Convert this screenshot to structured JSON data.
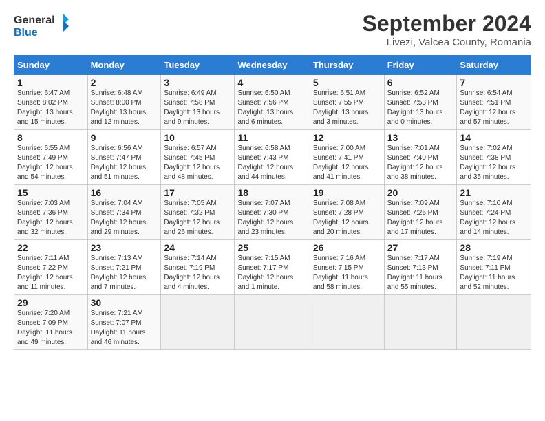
{
  "header": {
    "logo_line1": "General",
    "logo_line2": "Blue",
    "month": "September 2024",
    "location": "Livezi, Valcea County, Romania"
  },
  "weekdays": [
    "Sunday",
    "Monday",
    "Tuesday",
    "Wednesday",
    "Thursday",
    "Friday",
    "Saturday"
  ],
  "weeks": [
    [
      {
        "day": "1",
        "info": "Sunrise: 6:47 AM\nSunset: 8:02 PM\nDaylight: 13 hours\nand 15 minutes."
      },
      {
        "day": "2",
        "info": "Sunrise: 6:48 AM\nSunset: 8:00 PM\nDaylight: 13 hours\nand 12 minutes."
      },
      {
        "day": "3",
        "info": "Sunrise: 6:49 AM\nSunset: 7:58 PM\nDaylight: 13 hours\nand 9 minutes."
      },
      {
        "day": "4",
        "info": "Sunrise: 6:50 AM\nSunset: 7:56 PM\nDaylight: 13 hours\nand 6 minutes."
      },
      {
        "day": "5",
        "info": "Sunrise: 6:51 AM\nSunset: 7:55 PM\nDaylight: 13 hours\nand 3 minutes."
      },
      {
        "day": "6",
        "info": "Sunrise: 6:52 AM\nSunset: 7:53 PM\nDaylight: 13 hours\nand 0 minutes."
      },
      {
        "day": "7",
        "info": "Sunrise: 6:54 AM\nSunset: 7:51 PM\nDaylight: 12 hours\nand 57 minutes."
      }
    ],
    [
      {
        "day": "8",
        "info": "Sunrise: 6:55 AM\nSunset: 7:49 PM\nDaylight: 12 hours\nand 54 minutes."
      },
      {
        "day": "9",
        "info": "Sunrise: 6:56 AM\nSunset: 7:47 PM\nDaylight: 12 hours\nand 51 minutes."
      },
      {
        "day": "10",
        "info": "Sunrise: 6:57 AM\nSunset: 7:45 PM\nDaylight: 12 hours\nand 48 minutes."
      },
      {
        "day": "11",
        "info": "Sunrise: 6:58 AM\nSunset: 7:43 PM\nDaylight: 12 hours\nand 44 minutes."
      },
      {
        "day": "12",
        "info": "Sunrise: 7:00 AM\nSunset: 7:41 PM\nDaylight: 12 hours\nand 41 minutes."
      },
      {
        "day": "13",
        "info": "Sunrise: 7:01 AM\nSunset: 7:40 PM\nDaylight: 12 hours\nand 38 minutes."
      },
      {
        "day": "14",
        "info": "Sunrise: 7:02 AM\nSunset: 7:38 PM\nDaylight: 12 hours\nand 35 minutes."
      }
    ],
    [
      {
        "day": "15",
        "info": "Sunrise: 7:03 AM\nSunset: 7:36 PM\nDaylight: 12 hours\nand 32 minutes."
      },
      {
        "day": "16",
        "info": "Sunrise: 7:04 AM\nSunset: 7:34 PM\nDaylight: 12 hours\nand 29 minutes."
      },
      {
        "day": "17",
        "info": "Sunrise: 7:05 AM\nSunset: 7:32 PM\nDaylight: 12 hours\nand 26 minutes."
      },
      {
        "day": "18",
        "info": "Sunrise: 7:07 AM\nSunset: 7:30 PM\nDaylight: 12 hours\nand 23 minutes."
      },
      {
        "day": "19",
        "info": "Sunrise: 7:08 AM\nSunset: 7:28 PM\nDaylight: 12 hours\nand 20 minutes."
      },
      {
        "day": "20",
        "info": "Sunrise: 7:09 AM\nSunset: 7:26 PM\nDaylight: 12 hours\nand 17 minutes."
      },
      {
        "day": "21",
        "info": "Sunrise: 7:10 AM\nSunset: 7:24 PM\nDaylight: 12 hours\nand 14 minutes."
      }
    ],
    [
      {
        "day": "22",
        "info": "Sunrise: 7:11 AM\nSunset: 7:22 PM\nDaylight: 12 hours\nand 11 minutes."
      },
      {
        "day": "23",
        "info": "Sunrise: 7:13 AM\nSunset: 7:21 PM\nDaylight: 12 hours\nand 7 minutes."
      },
      {
        "day": "24",
        "info": "Sunrise: 7:14 AM\nSunset: 7:19 PM\nDaylight: 12 hours\nand 4 minutes."
      },
      {
        "day": "25",
        "info": "Sunrise: 7:15 AM\nSunset: 7:17 PM\nDaylight: 12 hours\nand 1 minute."
      },
      {
        "day": "26",
        "info": "Sunrise: 7:16 AM\nSunset: 7:15 PM\nDaylight: 11 hours\nand 58 minutes."
      },
      {
        "day": "27",
        "info": "Sunrise: 7:17 AM\nSunset: 7:13 PM\nDaylight: 11 hours\nand 55 minutes."
      },
      {
        "day": "28",
        "info": "Sunrise: 7:19 AM\nSunset: 7:11 PM\nDaylight: 11 hours\nand 52 minutes."
      }
    ],
    [
      {
        "day": "29",
        "info": "Sunrise: 7:20 AM\nSunset: 7:09 PM\nDaylight: 11 hours\nand 49 minutes."
      },
      {
        "day": "30",
        "info": "Sunrise: 7:21 AM\nSunset: 7:07 PM\nDaylight: 11 hours\nand 46 minutes."
      },
      {
        "day": "",
        "info": ""
      },
      {
        "day": "",
        "info": ""
      },
      {
        "day": "",
        "info": ""
      },
      {
        "day": "",
        "info": ""
      },
      {
        "day": "",
        "info": ""
      }
    ]
  ]
}
